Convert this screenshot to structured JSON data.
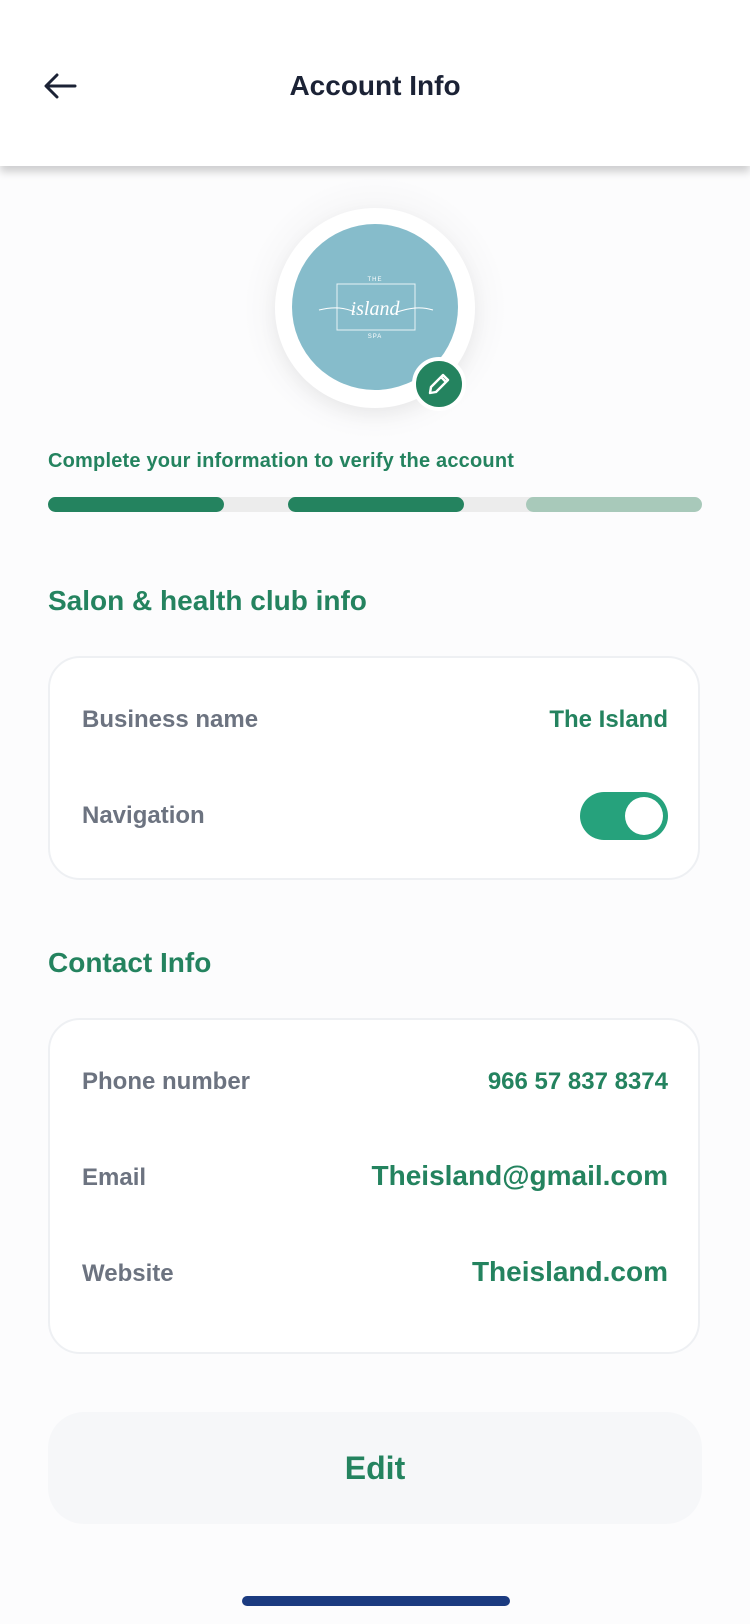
{
  "header": {
    "title": "Account Info",
    "back_icon": "arrow-left-icon"
  },
  "avatar": {
    "logo": {
      "top": "THE",
      "script": "island",
      "bottom": "SPA"
    },
    "logo_bg_color": "#86bccb",
    "edit_icon": "pencil-icon"
  },
  "verification": {
    "message": "Complete your information to verify the account",
    "steps": [
      {
        "state": "complete"
      },
      {
        "state": "complete"
      },
      {
        "state": "partial"
      }
    ]
  },
  "salon_section": {
    "title": "Salon & health club info",
    "rows": [
      {
        "label": "Business name",
        "value": "The Island"
      },
      {
        "label": "Navigation",
        "toggle_on": true
      }
    ]
  },
  "contact_section": {
    "title": "Contact Info",
    "rows": [
      {
        "label": "Phone number",
        "value": "966 57 837 8374"
      },
      {
        "label": "Email",
        "value": "Theisland@gmail.com"
      },
      {
        "label": "Website",
        "value": "Theisland.com"
      }
    ]
  },
  "actions": {
    "edit_label": "Edit"
  },
  "colors": {
    "accent": "#24835f",
    "toggle": "#26a27c",
    "progress_done": "#24835f",
    "progress_partial": "#a8c9ba",
    "label_gray": "#6c7380"
  }
}
